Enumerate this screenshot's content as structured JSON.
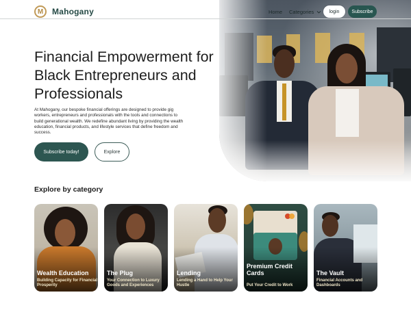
{
  "brand": {
    "name": "Mahogany",
    "logo_letter": "M"
  },
  "nav": {
    "home": "Home",
    "categories": "Categories",
    "login": "login",
    "subscribe": "Subscribe"
  },
  "hero": {
    "title": "Financial Empowerment for Black Entrepreneurs and Professionals",
    "description": "At Mahogany, our bespoke financial offerings are designed to provide gig workers, entrepreneurs and professionals with the tools and connections to build generational wealth. We redefine abundant living by providing the wealth education, financial products, and lifestyle services that define freedom and success.",
    "cta_primary": "Subscribe today!",
    "cta_secondary": "Explore"
  },
  "categories_section": {
    "title": "Explore by category",
    "cards": [
      {
        "title": "Wealth Education",
        "subtitle": "Building Capacity for Financial Prosperity"
      },
      {
        "title": "The Plug",
        "subtitle": "Your Connection to Luxury Goods and Experiences"
      },
      {
        "title": "Lending",
        "subtitle": "Lending a Hand to Help Your Hustle"
      },
      {
        "title": "Premium Credit Cards",
        "subtitle": "Put Your Credit to Work"
      },
      {
        "title": "The Vault",
        "subtitle": "Financial Accounts and Dashboards"
      }
    ]
  },
  "colors": {
    "brand_green": "#285650",
    "logo_gold": "#c19a57"
  },
  "icons": {
    "categories_caret": "chevron-down-icon",
    "logo": "mahogany-logo-icon"
  }
}
